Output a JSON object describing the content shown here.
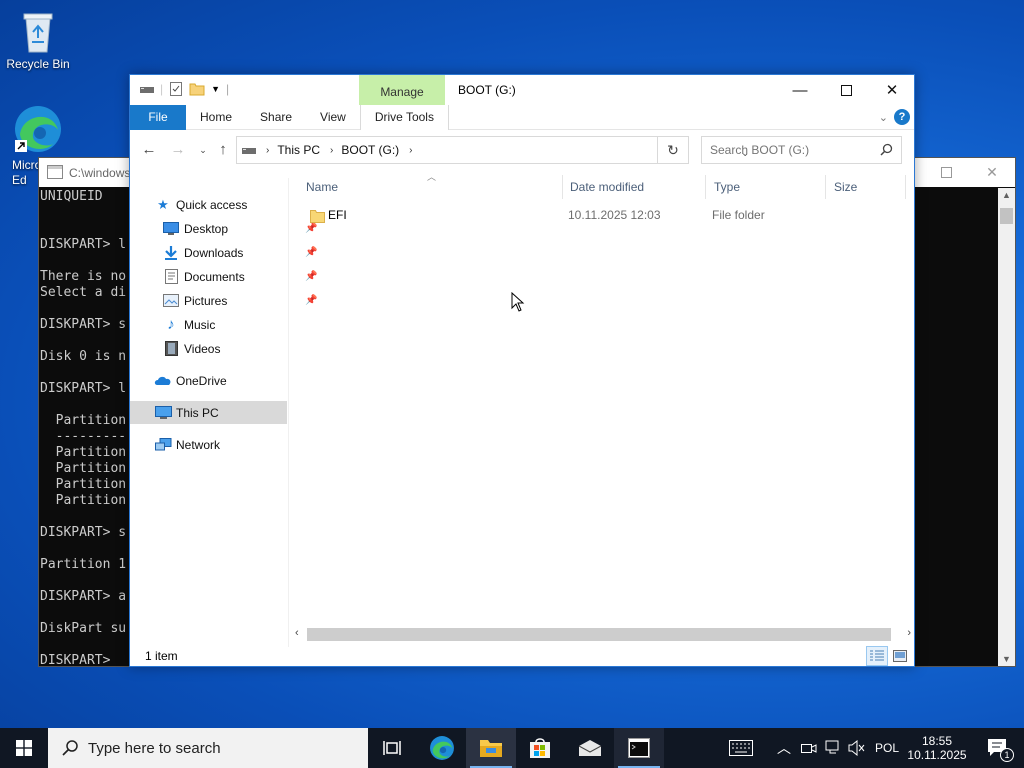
{
  "desktop": {
    "icons": [
      {
        "label": "Recycle Bin",
        "icon": "recycle-bin-icon"
      },
      {
        "label": "Micro\nEd",
        "icon": "edge-icon"
      }
    ]
  },
  "console": {
    "title": "C:\\windows",
    "lines": "UNIQUEID\n\n\nDISKPART> l\n\nThere is no\nSelect a di\n\nDISKPART> s\n\nDisk 0 is n\n\nDISKPART> l\n\n  Partition\n  ---------\n  Partition\n  Partition\n  Partition\n  Partition\n\nDISKPART> s\n\nPartition 1\n\nDISKPART> a\n\nDiskPart su\n\nDISKPART> "
  },
  "explorer": {
    "title": "BOOT (G:)",
    "manage_label": "Manage",
    "tabs": {
      "file": "File",
      "home": "Home",
      "share": "Share",
      "view": "View",
      "drive_tools": "Drive Tools"
    },
    "breadcrumb": [
      "This PC",
      "BOOT (G:)"
    ],
    "search_placeholder": "Search BOOT (G:)",
    "nav": {
      "quick_access": "Quick access",
      "desktop": "Desktop",
      "downloads": "Downloads",
      "documents": "Documents",
      "pictures": "Pictures",
      "music": "Music",
      "videos": "Videos",
      "onedrive": "OneDrive",
      "this_pc": "This PC",
      "network": "Network"
    },
    "columns": {
      "name": "Name",
      "date": "Date modified",
      "type": "Type",
      "size": "Size"
    },
    "files": [
      {
        "name": "EFI",
        "date": "10.11.2025 12:03",
        "type": "File folder",
        "size": ""
      }
    ],
    "status": "1 item"
  },
  "taskbar": {
    "search_placeholder": "Type here to search",
    "language": "POL",
    "time": "18:55",
    "date": "10.11.2025",
    "notifications": "1"
  },
  "colors": {
    "accent": "#1979ca",
    "manage_tab": "#c7efa9",
    "taskbar": "#101723"
  }
}
